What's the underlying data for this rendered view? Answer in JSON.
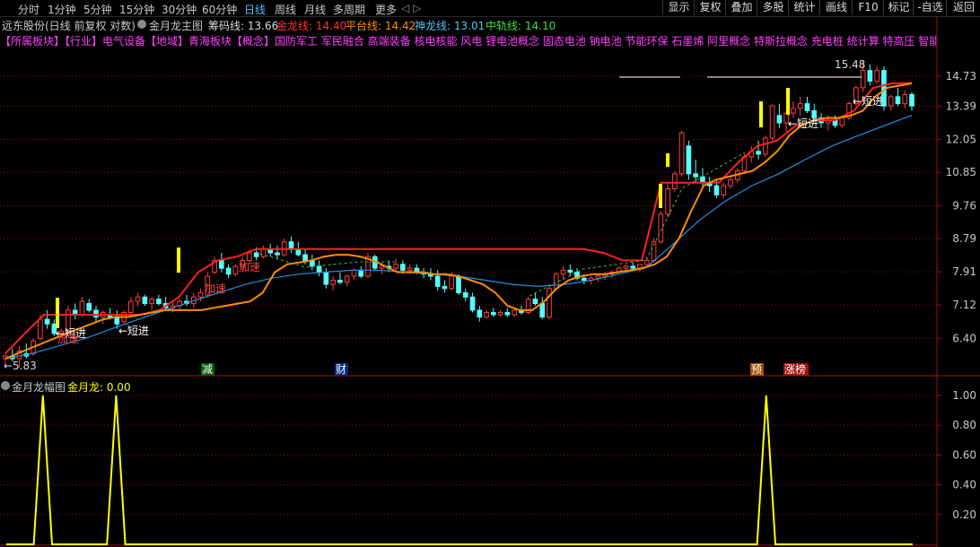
{
  "toolbar": {
    "periods": [
      "分时",
      "1分钟",
      "5分钟",
      "15分钟",
      "30分钟",
      "60分钟",
      "日线",
      "周线",
      "月线",
      "多周期",
      "更多"
    ],
    "active_period": "日线",
    "nav_arrows": "◁ ▷",
    "right_buttons": [
      "显示",
      "复权",
      "叠加",
      "多股",
      "统计",
      "画线",
      "F10",
      "标记",
      "-自选",
      "返回"
    ]
  },
  "header": {
    "stock_title": "远东股份(日线 前复权 对数)",
    "indicator_name": "金月龙主图",
    "chip_label": "筹码线: 13.66",
    "gold_label": "金龙线: 14.40",
    "platform_label": "平台线: 14.42",
    "god_label": "神龙线: 13.01",
    "mid_label": "中轨线: 14.10"
  },
  "concepts": "【所属板块】【行业】电气设备【地域】青海板块【概念】国防军工 军民融合 高端装备 核电核能 风电 锂电池概念 固态电池 钠电池 节能环保 石墨烯 阿里概念 特斯拉概念 充电桩 统计算 特高压 智能电网",
  "colors": {
    "up_candle": "#ff3c3c",
    "down_candle": "#54ffff",
    "ma_orange": "#ff8c00",
    "platform_red": "#ff2020",
    "god_line": "#2090e0",
    "chip_green": "#40c040",
    "signal_yellow": "#ffff00",
    "grid_red": "#801010"
  },
  "annotations": {
    "low_price": "←5.83",
    "high_price": "15.48",
    "short_in": "←短进",
    "accelerate": "加速",
    "jian": "减",
    "cai": "财",
    "yu": "预",
    "limit_list": "涨榜"
  },
  "sub_header": {
    "name": "金月龙幅图",
    "value_label": "金月龙: 0.00"
  },
  "chart_data": [
    {
      "type": "candlestick",
      "title": "金月龙主图",
      "y_scale": "log",
      "ylim": [
        5.7,
        16.0
      ],
      "y_ticks": [
        "14.73",
        "13.39",
        "12.05",
        "10.85",
        "9.76",
        "8.79",
        "7.91",
        "7.12",
        "6.40"
      ],
      "grid": true,
      "candles": [
        [
          6.0,
          6.1,
          5.9,
          6.05
        ],
        [
          6.05,
          6.2,
          5.95,
          6.0
        ],
        [
          6.0,
          6.25,
          5.83,
          6.15
        ],
        [
          6.1,
          6.3,
          6.0,
          6.05
        ],
        [
          6.1,
          6.4,
          6.05,
          6.35
        ],
        [
          6.4,
          6.9,
          6.35,
          6.8
        ],
        [
          6.8,
          7.0,
          6.6,
          6.7
        ],
        [
          6.7,
          6.8,
          6.45,
          6.5
        ],
        [
          6.5,
          6.6,
          6.4,
          6.55
        ],
        [
          6.55,
          7.1,
          6.5,
          7.0
        ],
        [
          7.0,
          7.15,
          6.8,
          6.9
        ],
        [
          6.9,
          7.3,
          6.85,
          7.2
        ],
        [
          7.15,
          7.25,
          6.95,
          7.0
        ],
        [
          7.0,
          7.1,
          6.75,
          6.85
        ],
        [
          6.85,
          7.0,
          6.7,
          6.95
        ],
        [
          6.9,
          7.05,
          6.8,
          6.85
        ],
        [
          6.85,
          7.0,
          6.6,
          6.7
        ],
        [
          6.75,
          7.0,
          6.7,
          6.95
        ],
        [
          6.95,
          7.3,
          6.9,
          7.2
        ],
        [
          7.2,
          7.4,
          7.1,
          7.3
        ],
        [
          7.3,
          7.35,
          7.1,
          7.15
        ],
        [
          7.15,
          7.3,
          7.0,
          7.25
        ],
        [
          7.25,
          7.35,
          7.1,
          7.15
        ],
        [
          7.15,
          7.3,
          7.0,
          7.05
        ],
        [
          7.05,
          7.2,
          6.95,
          7.1
        ],
        [
          7.1,
          7.25,
          7.0,
          7.2
        ],
        [
          7.2,
          7.35,
          7.1,
          7.15
        ],
        [
          7.15,
          7.4,
          7.05,
          7.3
        ],
        [
          7.3,
          7.5,
          7.2,
          7.4
        ],
        [
          7.35,
          7.9,
          7.3,
          7.8
        ],
        [
          7.9,
          8.3,
          7.85,
          8.2
        ],
        [
          8.2,
          8.4,
          7.9,
          8.0
        ],
        [
          8.0,
          8.1,
          7.75,
          7.85
        ],
        [
          7.85,
          8.1,
          7.8,
          8.05
        ],
        [
          8.05,
          8.3,
          7.95,
          8.2
        ],
        [
          8.2,
          8.5,
          8.1,
          8.4
        ],
        [
          8.4,
          8.55,
          8.2,
          8.3
        ],
        [
          8.3,
          8.6,
          8.25,
          8.5
        ],
        [
          8.5,
          8.65,
          8.3,
          8.4
        ],
        [
          8.4,
          8.6,
          8.25,
          8.35
        ],
        [
          8.35,
          8.8,
          8.3,
          8.7
        ],
        [
          8.7,
          8.85,
          8.4,
          8.5
        ],
        [
          8.5,
          8.7,
          8.3,
          8.35
        ],
        [
          8.35,
          8.5,
          8.1,
          8.2
        ],
        [
          8.2,
          8.35,
          7.95,
          8.05
        ],
        [
          8.05,
          8.2,
          7.8,
          7.9
        ],
        [
          7.9,
          8.0,
          7.5,
          7.6
        ],
        [
          7.6,
          7.8,
          7.45,
          7.7
        ],
        [
          7.7,
          7.9,
          7.6,
          7.65
        ],
        [
          7.65,
          7.85,
          7.55,
          7.8
        ],
        [
          7.8,
          8.0,
          7.7,
          7.95
        ],
        [
          7.95,
          8.05,
          7.75,
          7.8
        ],
        [
          7.8,
          8.4,
          7.75,
          8.3
        ],
        [
          8.3,
          8.35,
          7.95,
          8.0
        ],
        [
          8.0,
          8.15,
          7.85,
          8.05
        ],
        [
          8.05,
          8.2,
          7.9,
          8.0
        ],
        [
          8.0,
          8.25,
          7.9,
          8.1
        ],
        [
          8.1,
          8.2,
          7.85,
          7.95
        ],
        [
          7.95,
          8.1,
          7.85,
          8.0
        ],
        [
          8.0,
          8.1,
          7.85,
          7.9
        ],
        [
          7.9,
          8.0,
          7.75,
          7.85
        ],
        [
          7.85,
          8.0,
          7.7,
          7.8
        ],
        [
          7.8,
          7.95,
          7.45,
          7.55
        ],
        [
          7.55,
          7.7,
          7.4,
          7.5
        ],
        [
          7.5,
          7.9,
          7.45,
          7.8
        ],
        [
          7.8,
          7.85,
          7.35,
          7.4
        ],
        [
          7.4,
          7.5,
          7.2,
          7.3
        ],
        [
          7.3,
          7.4,
          6.95,
          7.0
        ],
        [
          7.0,
          7.1,
          6.75,
          6.85
        ],
        [
          6.85,
          7.0,
          6.8,
          6.95
        ],
        [
          6.95,
          7.05,
          6.85,
          6.9
        ],
        [
          6.9,
          7.0,
          6.85,
          6.95
        ],
        [
          6.95,
          7.05,
          6.85,
          6.9
        ],
        [
          6.9,
          7.05,
          6.85,
          7.0
        ],
        [
          7.0,
          7.1,
          6.9,
          6.95
        ],
        [
          6.95,
          7.3,
          6.9,
          7.25
        ],
        [
          7.25,
          7.4,
          7.1,
          7.15
        ],
        [
          7.15,
          7.3,
          6.8,
          6.85
        ],
        [
          6.85,
          7.6,
          6.8,
          7.5
        ],
        [
          7.5,
          7.9,
          7.45,
          7.85
        ],
        [
          7.85,
          8.05,
          7.7,
          7.95
        ],
        [
          7.95,
          8.1,
          7.8,
          7.9
        ],
        [
          7.9,
          8.0,
          7.7,
          7.75
        ],
        [
          7.75,
          7.85,
          7.6,
          7.7
        ],
        [
          7.7,
          7.8,
          7.6,
          7.75
        ],
        [
          7.75,
          7.85,
          7.65,
          7.8
        ],
        [
          7.8,
          7.9,
          7.7,
          7.85
        ],
        [
          7.85,
          7.95,
          7.75,
          7.9
        ],
        [
          7.9,
          8.05,
          7.85,
          8.0
        ],
        [
          8.0,
          8.1,
          7.9,
          8.05
        ],
        [
          8.05,
          8.15,
          7.95,
          8.0
        ],
        [
          8.0,
          8.1,
          7.9,
          8.1
        ],
        [
          8.1,
          8.3,
          8.05,
          8.2
        ],
        [
          8.2,
          8.8,
          8.15,
          8.7
        ],
        [
          8.7,
          9.6,
          8.65,
          9.5
        ],
        [
          9.5,
          10.5,
          9.4,
          10.3
        ],
        [
          10.3,
          10.9,
          10.2,
          10.8
        ],
        [
          10.8,
          12.4,
          10.7,
          12.3
        ],
        [
          11.8,
          12.0,
          10.6,
          10.8
        ],
        [
          10.8,
          11.3,
          10.5,
          10.7
        ],
        [
          10.7,
          11.0,
          10.4,
          10.5
        ],
        [
          10.5,
          10.7,
          10.2,
          10.4
        ],
        [
          10.4,
          10.6,
          10.0,
          10.1
        ],
        [
          10.1,
          10.5,
          10.0,
          10.4
        ],
        [
          10.4,
          10.7,
          10.3,
          10.6
        ],
        [
          10.6,
          11.0,
          10.5,
          10.9
        ],
        [
          10.9,
          11.5,
          10.8,
          11.4
        ],
        [
          11.4,
          11.8,
          11.2,
          11.6
        ],
        [
          11.6,
          12.0,
          11.3,
          11.5
        ],
        [
          11.5,
          12.2,
          11.4,
          12.1
        ],
        [
          12.1,
          13.5,
          12.0,
          13.4
        ],
        [
          13.0,
          13.5,
          12.5,
          12.7
        ],
        [
          12.7,
          13.2,
          12.3,
          13.1
        ],
        [
          13.1,
          13.6,
          12.9,
          13.3
        ],
        [
          13.3,
          13.8,
          13.0,
          13.5
        ],
        [
          13.5,
          13.8,
          13.1,
          13.2
        ],
        [
          13.2,
          13.5,
          12.8,
          12.9
        ],
        [
          12.9,
          13.1,
          12.5,
          12.7
        ],
        [
          12.7,
          13.0,
          12.4,
          12.8
        ],
        [
          12.8,
          13.0,
          12.5,
          12.6
        ],
        [
          12.6,
          13.0,
          12.5,
          12.9
        ],
        [
          12.9,
          13.6,
          12.8,
          13.5
        ],
        [
          13.5,
          14.3,
          13.4,
          14.2
        ],
        [
          14.2,
          15.48,
          14.0,
          15.0
        ],
        [
          15.0,
          15.3,
          14.3,
          14.5
        ],
        [
          14.5,
          15.2,
          14.4,
          15.0
        ],
        [
          15.0,
          15.2,
          13.2,
          13.4
        ],
        [
          13.4,
          13.9,
          13.2,
          13.8
        ],
        [
          13.8,
          14.2,
          13.4,
          13.5
        ],
        [
          13.5,
          14.1,
          13.3,
          13.9
        ],
        [
          13.9,
          14.0,
          13.2,
          13.4
        ]
      ],
      "series": [
        {
          "name": "金龙线",
          "values": [
            6.0,
            6.1,
            6.2,
            6.3,
            6.4,
            6.5,
            6.6,
            6.7,
            6.8,
            6.85,
            6.85,
            6.9,
            6.95,
            7.0,
            7.0,
            7.0,
            7.0,
            7.05,
            7.1,
            7.15,
            7.2,
            7.4,
            7.9,
            8.1,
            8.15,
            8.2,
            8.3,
            8.35,
            8.35,
            8.3,
            8.2,
            8.05,
            7.9,
            7.9,
            7.9,
            7.85,
            7.85,
            7.8,
            7.7,
            7.6,
            7.4,
            7.1,
            7.0,
            7.0,
            7.2,
            7.5,
            7.7,
            7.8,
            7.85,
            7.85,
            7.9,
            7.95,
            8.0,
            8.1,
            8.3,
            8.8,
            9.6,
            10.4,
            10.6,
            10.7,
            10.8,
            10.9,
            11.2,
            11.6,
            12.2,
            12.6,
            12.8,
            12.9,
            12.9,
            13.0,
            13.2,
            13.8,
            14.2,
            14.3,
            14.4
          ]
        },
        {
          "name": "平台线",
          "values": [
            6.1,
            6.5,
            6.9,
            6.9,
            6.9,
            6.9,
            6.9,
            6.9,
            7.0,
            7.3,
            7.9,
            8.2,
            8.3,
            8.5,
            8.5,
            8.5,
            8.5,
            8.5,
            8.5,
            8.5,
            8.5,
            8.5,
            8.5,
            8.5,
            8.5,
            8.5,
            8.5,
            8.5,
            8.5,
            8.5,
            8.5,
            8.4,
            8.2,
            8.2,
            10.5,
            10.5,
            10.5,
            10.5,
            11.2,
            11.8,
            12.0,
            12.6,
            12.8,
            12.8,
            13.2,
            14.2,
            14.4,
            14.42
          ]
        },
        {
          "name": "神龙线",
          "values": [
            6.0,
            6.1,
            6.25,
            6.4,
            6.6,
            6.8,
            7.0,
            7.2,
            7.4,
            7.6,
            7.75,
            7.85,
            7.9,
            7.95,
            7.95,
            7.9,
            7.85,
            7.8,
            7.7,
            7.6,
            7.55,
            7.6,
            7.7,
            7.85,
            8.0,
            8.6,
            9.3,
            9.9,
            10.4,
            10.8,
            11.3,
            11.8,
            12.2,
            12.6,
            13.01
          ]
        }
      ]
    },
    {
      "type": "line",
      "title": "金月龙幅图",
      "ylim": [
        0,
        1
      ],
      "y_ticks": [
        "1.00",
        "0.80",
        "0.60",
        "0.40",
        "0.20"
      ],
      "grid": true,
      "series": [
        {
          "name": "金月龙",
          "values": [
            0,
            0,
            0,
            0,
            1,
            0,
            0,
            0,
            0,
            0,
            0,
            0,
            1,
            0,
            0,
            0,
            0,
            0,
            0,
            0,
            0,
            0,
            0,
            0,
            0,
            0,
            0,
            0,
            0,
            0,
            0,
            0,
            0,
            0,
            0,
            0,
            0,
            0,
            0,
            0,
            0,
            0,
            0,
            0,
            0,
            0,
            0,
            0,
            0,
            0,
            0,
            0,
            0,
            0,
            0,
            0,
            0,
            0,
            0,
            0,
            0,
            0,
            0,
            0,
            0,
            0,
            0,
            0,
            0,
            0,
            0,
            0,
            0,
            0,
            0,
            0,
            0,
            0,
            0,
            0,
            0,
            0,
            0,
            1,
            0,
            0,
            0,
            0,
            0,
            0,
            0,
            0,
            0,
            0,
            0,
            0,
            0,
            0,
            0,
            0
          ]
        }
      ]
    }
  ]
}
